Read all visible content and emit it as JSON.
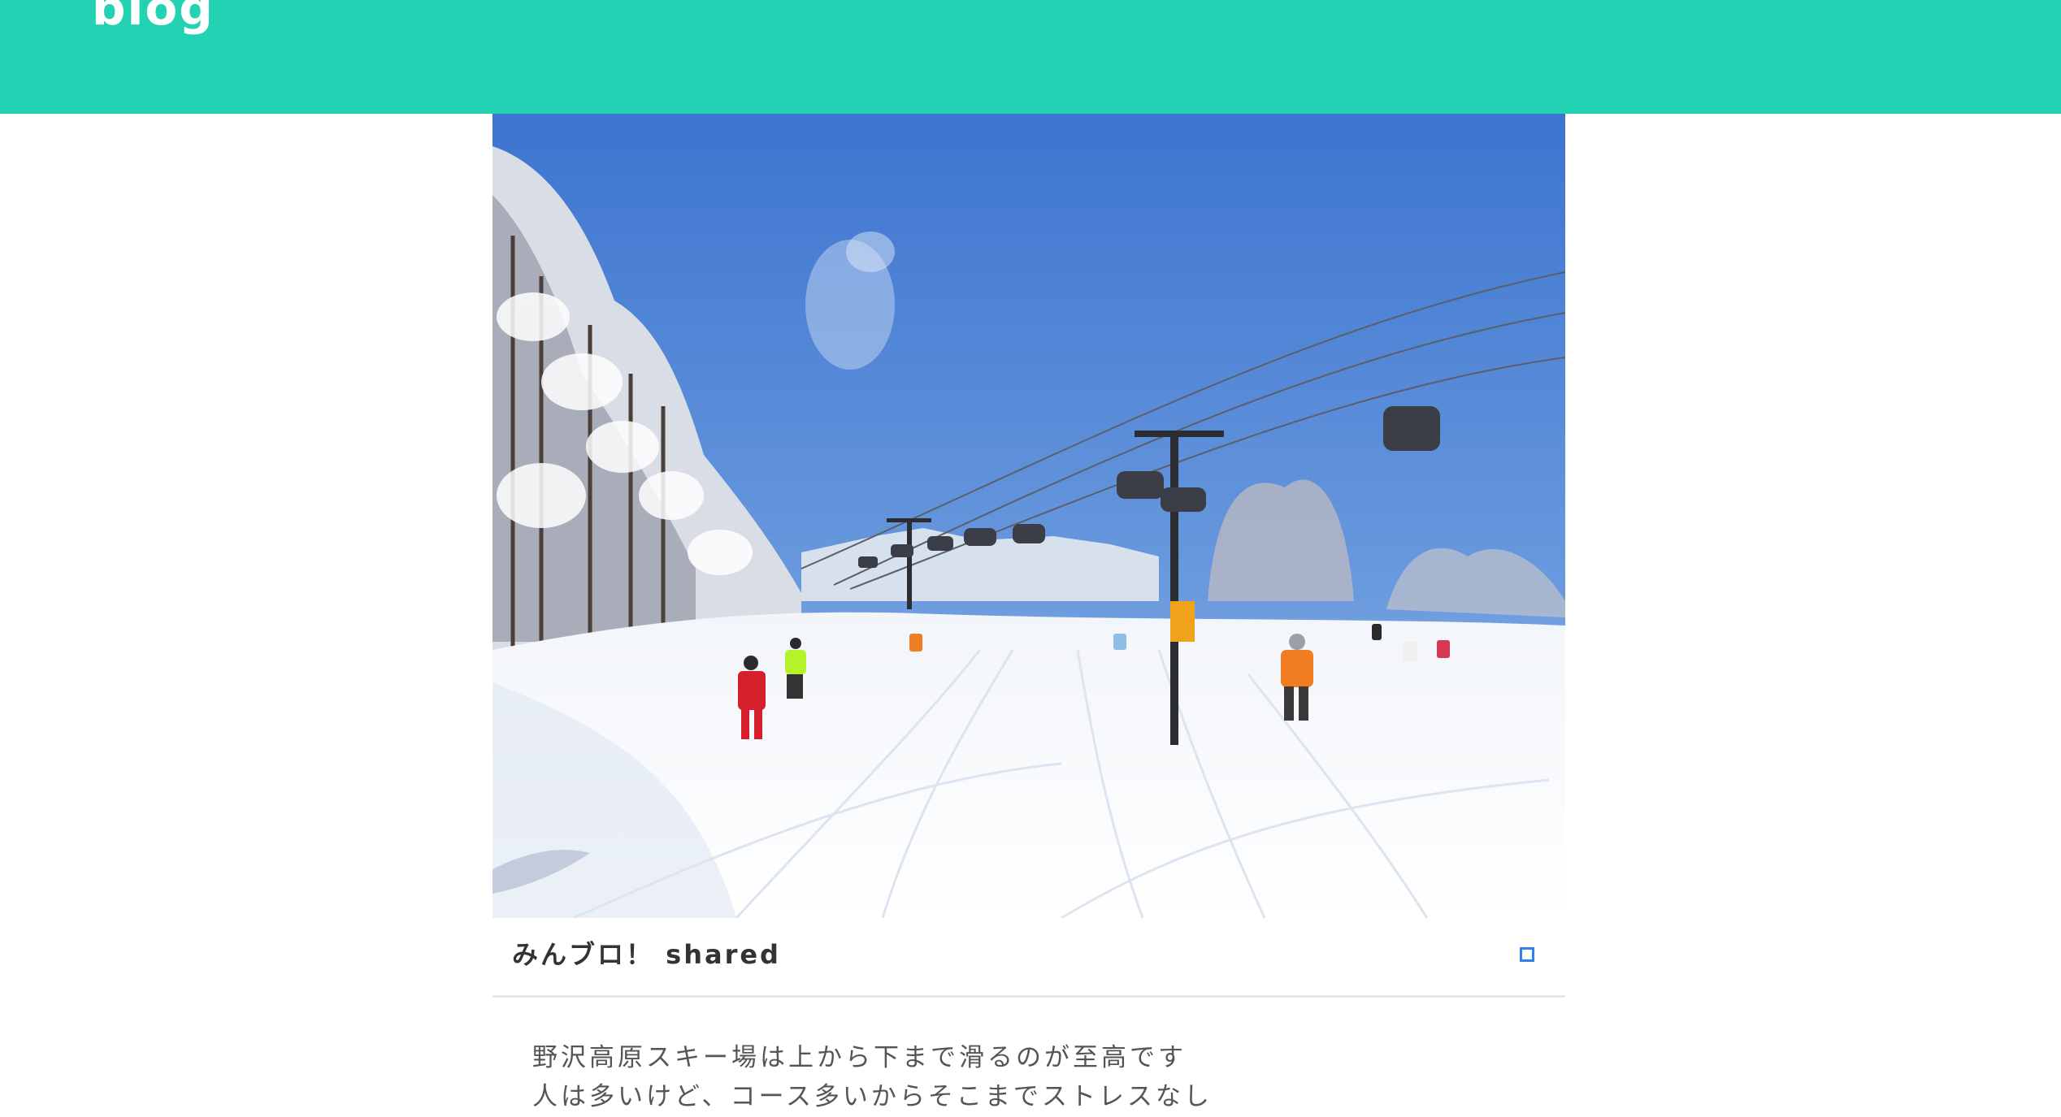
{
  "header": {
    "brand": "blog",
    "color": "#23d2b2"
  },
  "post": {
    "image_alt": "ski slope with chairlift",
    "card_title": "みんブロ！ shared",
    "share_icon": "square-outline-icon",
    "body_lines": [
      "野沢高原スキー場は上から下まで滑るのが至高です",
      "人は多いけど、コース多いからそこまでストレスなし"
    ]
  }
}
